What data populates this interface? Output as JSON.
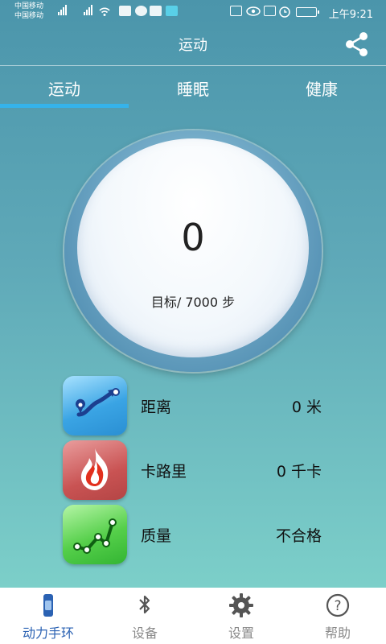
{
  "status_bar": {
    "carrier_1": "中国移动",
    "carrier_2": "中国移动",
    "time": "上午9:21"
  },
  "header": {
    "title": "运动"
  },
  "tabs": [
    {
      "label": "运动",
      "active": true
    },
    {
      "label": "睡眠",
      "active": false
    },
    {
      "label": "健康",
      "active": false
    }
  ],
  "summary": {
    "steps": "0",
    "goal": "目标/ 7000 步"
  },
  "stats": [
    {
      "label": "距离",
      "value": "0 米",
      "icon": "route-icon"
    },
    {
      "label": "卡路里",
      "value": "0 千卡",
      "icon": "flame-icon"
    },
    {
      "label": "质量",
      "value": "不合格",
      "icon": "trend-icon"
    }
  ],
  "nav": [
    {
      "label": "动力手环",
      "icon": "band-icon",
      "active": true
    },
    {
      "label": "设备",
      "icon": "bluetooth-icon",
      "active": false
    },
    {
      "label": "设置",
      "icon": "gear-icon",
      "active": false
    },
    {
      "label": "帮助",
      "icon": "help-icon",
      "active": false
    }
  ],
  "colors": {
    "accent": "#35b3ea",
    "nav_active": "#2b62b3",
    "bg_top": "#4b95ab",
    "bg_bottom": "#7ccfc9"
  }
}
